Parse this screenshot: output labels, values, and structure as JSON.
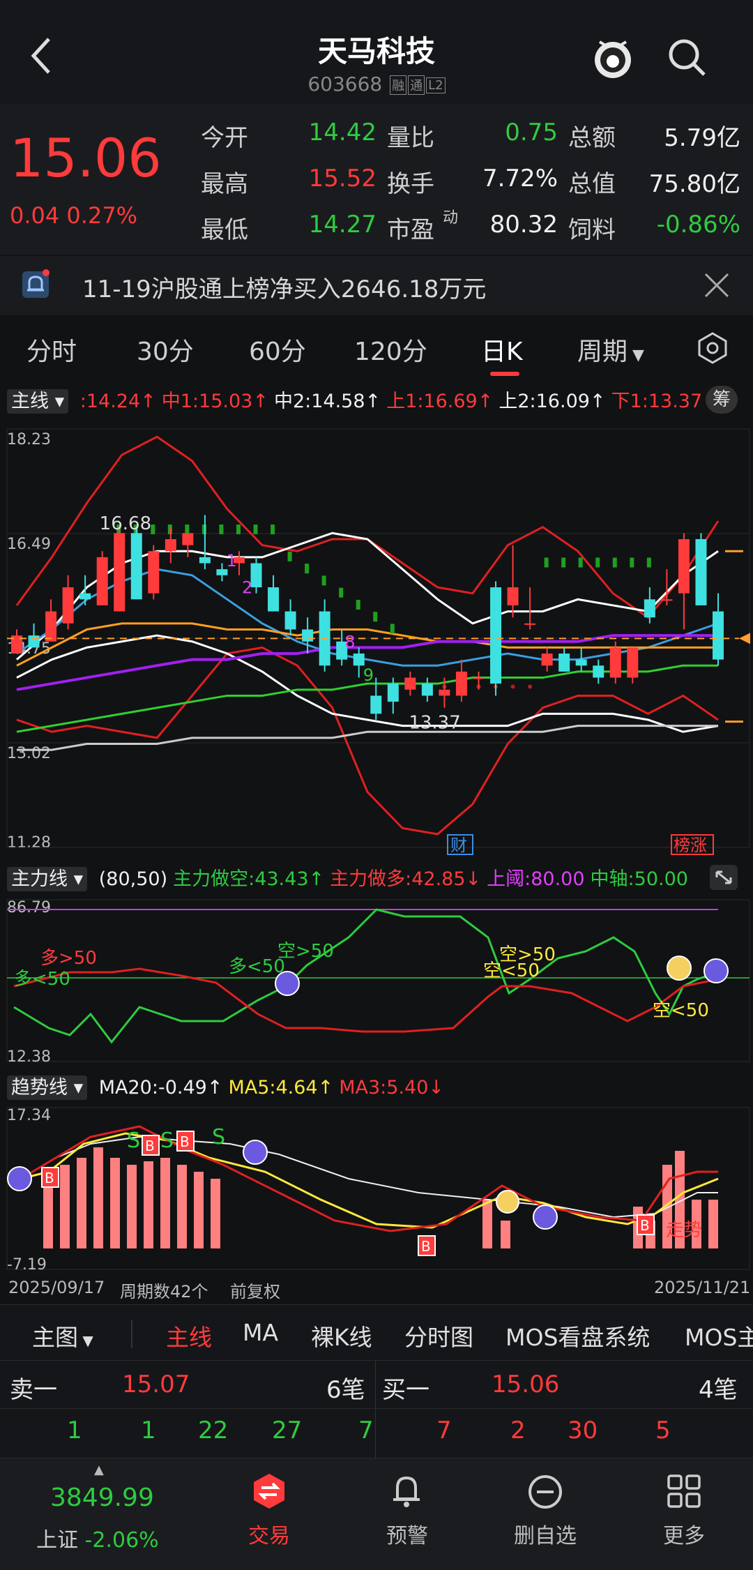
{
  "header": {
    "title": "天马科技",
    "code": "603668",
    "tags": [
      "融",
      "通",
      "L2"
    ]
  },
  "quote": {
    "price": "15.06",
    "change": "0.04",
    "change_pct": "0.27%",
    "rows": [
      [
        {
          "l": "今开",
          "v": "14.42",
          "c": "green"
        },
        {
          "l": "量比",
          "v": "0.75",
          "c": "green"
        },
        {
          "l": "总额",
          "v": "5.79亿",
          "c": "white"
        }
      ],
      [
        {
          "l": "最高",
          "v": "15.52",
          "c": "red"
        },
        {
          "l": "换手",
          "v": "7.72%",
          "c": "white"
        },
        {
          "l": "总值",
          "v": "75.80亿",
          "c": "white"
        }
      ],
      [
        {
          "l": "最低",
          "v": "14.27",
          "c": "green"
        },
        {
          "l": "市盈",
          "sup": "动",
          "v": "80.32",
          "c": "white"
        },
        {
          "l": "饲料",
          "v": "-0.86%",
          "c": "green"
        }
      ]
    ]
  },
  "notice": {
    "text": "11-19沪股通上榜净买入2646.18万元"
  },
  "tabs": [
    "分时",
    "30分",
    "60分",
    "120分",
    "日K",
    "周期"
  ],
  "main_bar": {
    "selector": "主线",
    "items": [
      {
        "t": ":14.24↑",
        "c": "red"
      },
      {
        "t": "中1:15.03↑",
        "c": "red"
      },
      {
        "t": "中2:14.58↑",
        "c": "white"
      },
      {
        "t": "上1:16.69↑",
        "c": "red"
      },
      {
        "t": "上2:16.09↑",
        "c": "white"
      },
      {
        "t": "下1:13.37↓",
        "c": "red"
      }
    ],
    "chip_button": "筹"
  },
  "main_scale": [
    "18.23",
    "16.49",
    "14.75",
    "13.02",
    "11.28"
  ],
  "main_annotations": {
    "high": "16.68",
    "low": "13.37",
    "num1": "1",
    "num2": "2",
    "num8": "8",
    "num9": "9",
    "cai": "财",
    "bangzhang": "榜涨"
  },
  "sub1_bar": {
    "selector": "主力线",
    "items": [
      {
        "t": "(80,50)",
        "c": "white"
      },
      {
        "t": "主力做空:43.43↑",
        "c": "green"
      },
      {
        "t": "主力做多:42.85↓",
        "c": "red"
      },
      {
        "t": "上阈:80.00",
        "c": "magenta"
      },
      {
        "t": "中轴:50.00",
        "c": "green"
      }
    ]
  },
  "sub1_scale": [
    "86.79",
    "12.38"
  ],
  "sub1_labels": [
    {
      "t": "多>50",
      "c": "red"
    },
    {
      "t": "多<50",
      "c": "green"
    },
    {
      "t": "多<50",
      "c": "green"
    },
    {
      "t": "空>50",
      "c": "green"
    },
    {
      "t": "空>50",
      "c": "yellow"
    },
    {
      "t": "空<50",
      "c": "yellow"
    },
    {
      "t": "空<50",
      "c": "yellow"
    }
  ],
  "sub2_bar": {
    "selector": "趋势线",
    "items": [
      {
        "t": "MA20:-0.49↑",
        "c": "white"
      },
      {
        "t": "MA5:4.64↑",
        "c": "yellow"
      },
      {
        "t": "MA3:5.40↓",
        "c": "red"
      }
    ]
  },
  "sub2_scale": [
    "17.34",
    "-7.19"
  ],
  "sub2_labels": {
    "s": "S",
    "b": "B",
    "strong": "走势"
  },
  "footer_info": {
    "start": "2025/09/17",
    "count": "周期数42个",
    "adjust": "前复权",
    "end": "2025/11/21"
  },
  "indicator_tabs": [
    "主图",
    "主线",
    "MA",
    "裸K线",
    "分时图",
    "MOS看盘系统",
    "MOS主"
  ],
  "order_book": {
    "sell_label": "卖一",
    "sell_price": "15.07",
    "sell_count": "6笔",
    "buy_label": "买一",
    "buy_price": "15.06",
    "buy_count": "4笔",
    "sell_ticks": [
      "1",
      "1",
      "22",
      "27",
      "7"
    ],
    "buy_ticks": [
      "7",
      "2",
      "30",
      "5"
    ]
  },
  "nav": {
    "index_value": "3849.99",
    "index_name": "上证",
    "index_change": "-2.06%",
    "items": [
      "交易",
      "预警",
      "删自选",
      "更多"
    ]
  },
  "colors": {
    "up": "#ff3b3b",
    "down": "#2ecc40",
    "cyan": "#3fe0e0",
    "accent": "#ff3b3b"
  },
  "chart_data": {
    "type": "candlestick",
    "x_range": [
      "2025/09/17",
      "2025/11/21"
    ],
    "ylim": [
      11.28,
      18.23
    ],
    "ohlc": [
      [
        14.5,
        14.9,
        14.5,
        14.8
      ],
      [
        14.8,
        15.0,
        14.6,
        14.6
      ],
      [
        14.7,
        15.4,
        14.7,
        15.2
      ],
      [
        15.0,
        15.8,
        14.9,
        15.6
      ],
      [
        15.5,
        15.8,
        15.3,
        15.4
      ],
      [
        15.3,
        16.2,
        15.3,
        16.1
      ],
      [
        15.2,
        16.6,
        15.2,
        16.5
      ],
      [
        16.5,
        16.6,
        15.4,
        15.4
      ],
      [
        15.5,
        16.3,
        15.4,
        16.2
      ],
      [
        16.2,
        16.6,
        16.0,
        16.4
      ],
      [
        16.3,
        16.5,
        16.1,
        16.5
      ],
      [
        16.1,
        16.8,
        15.9,
        16.0
      ],
      [
        15.9,
        16.0,
        15.7,
        15.8
      ],
      [
        16.0,
        16.2,
        15.8,
        16.1
      ],
      [
        16.0,
        16.1,
        15.5,
        15.6
      ],
      [
        15.6,
        15.8,
        15.2,
        15.2
      ],
      [
        15.2,
        15.4,
        14.8,
        14.9
      ],
      [
        14.9,
        15.1,
        14.5,
        14.7
      ],
      [
        15.2,
        15.4,
        14.2,
        14.3
      ],
      [
        14.7,
        14.9,
        14.3,
        14.4
      ],
      [
        14.5,
        14.6,
        14.1,
        14.3
      ],
      [
        13.8,
        14.1,
        13.4,
        13.5
      ],
      [
        14.0,
        14.1,
        13.5,
        13.7
      ],
      [
        13.9,
        14.2,
        13.8,
        14.1
      ],
      [
        14.0,
        14.1,
        13.7,
        13.8
      ],
      [
        13.8,
        14.1,
        13.6,
        13.9
      ],
      [
        13.8,
        14.4,
        13.7,
        14.2
      ],
      [
        14.1,
        14.2,
        13.9,
        14.1
      ],
      [
        15.6,
        15.7,
        13.8,
        14.0
      ],
      [
        15.3,
        16.3,
        15.1,
        15.6
      ],
      [
        15.0,
        15.6,
        14.9,
        15.0
      ],
      [
        14.3,
        14.6,
        14.2,
        14.5
      ],
      [
        14.5,
        14.6,
        14.2,
        14.2
      ],
      [
        14.4,
        14.6,
        14.2,
        14.3
      ],
      [
        14.3,
        14.4,
        14.0,
        14.1
      ],
      [
        14.1,
        14.7,
        14.0,
        14.6
      ],
      [
        14.1,
        14.6,
        14.0,
        14.6
      ],
      [
        15.4,
        15.6,
        15.0,
        15.1
      ],
      [
        15.4,
        15.9,
        15.3,
        15.4
      ],
      [
        15.5,
        16.5,
        14.9,
        16.4
      ],
      [
        16.4,
        16.5,
        15.3,
        15.3
      ],
      [
        15.2,
        15.5,
        14.3,
        14.4
      ]
    ],
    "last_close": 15.06
  }
}
